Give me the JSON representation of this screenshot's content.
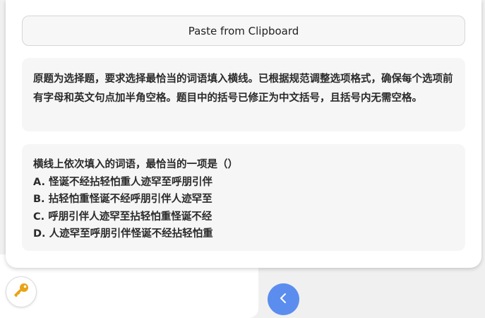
{
  "clipboard_button_label": "Paste from Clipboard",
  "note_text": "原题为选择题，要求选择最恰当的词语填入横线。已根据规范调整选项格式，确保每个选项前有字母和英文句点加半角空格。题目中的括号已修正为中文括号，且括号内无需空格。",
  "question": {
    "stem": "横线上依次填入的词语，最恰当的一项是（）",
    "options": [
      "A. 怪诞不经拈轻怕重人迹罕至呼朋引伴",
      "B. 拈轻怕重怪诞不经呼朋引伴人迹罕至",
      "C. 呼朋引伴人迹罕至拈轻怕重怪诞不经",
      "D. 人迹罕至呼朋引伴怪诞不经拈轻怕重"
    ]
  },
  "icons": {
    "key_button": "key-icon",
    "back_button": "chevron-left-icon"
  },
  "colors": {
    "back_button": "#5b8def",
    "key_icon": "#e8a317"
  }
}
